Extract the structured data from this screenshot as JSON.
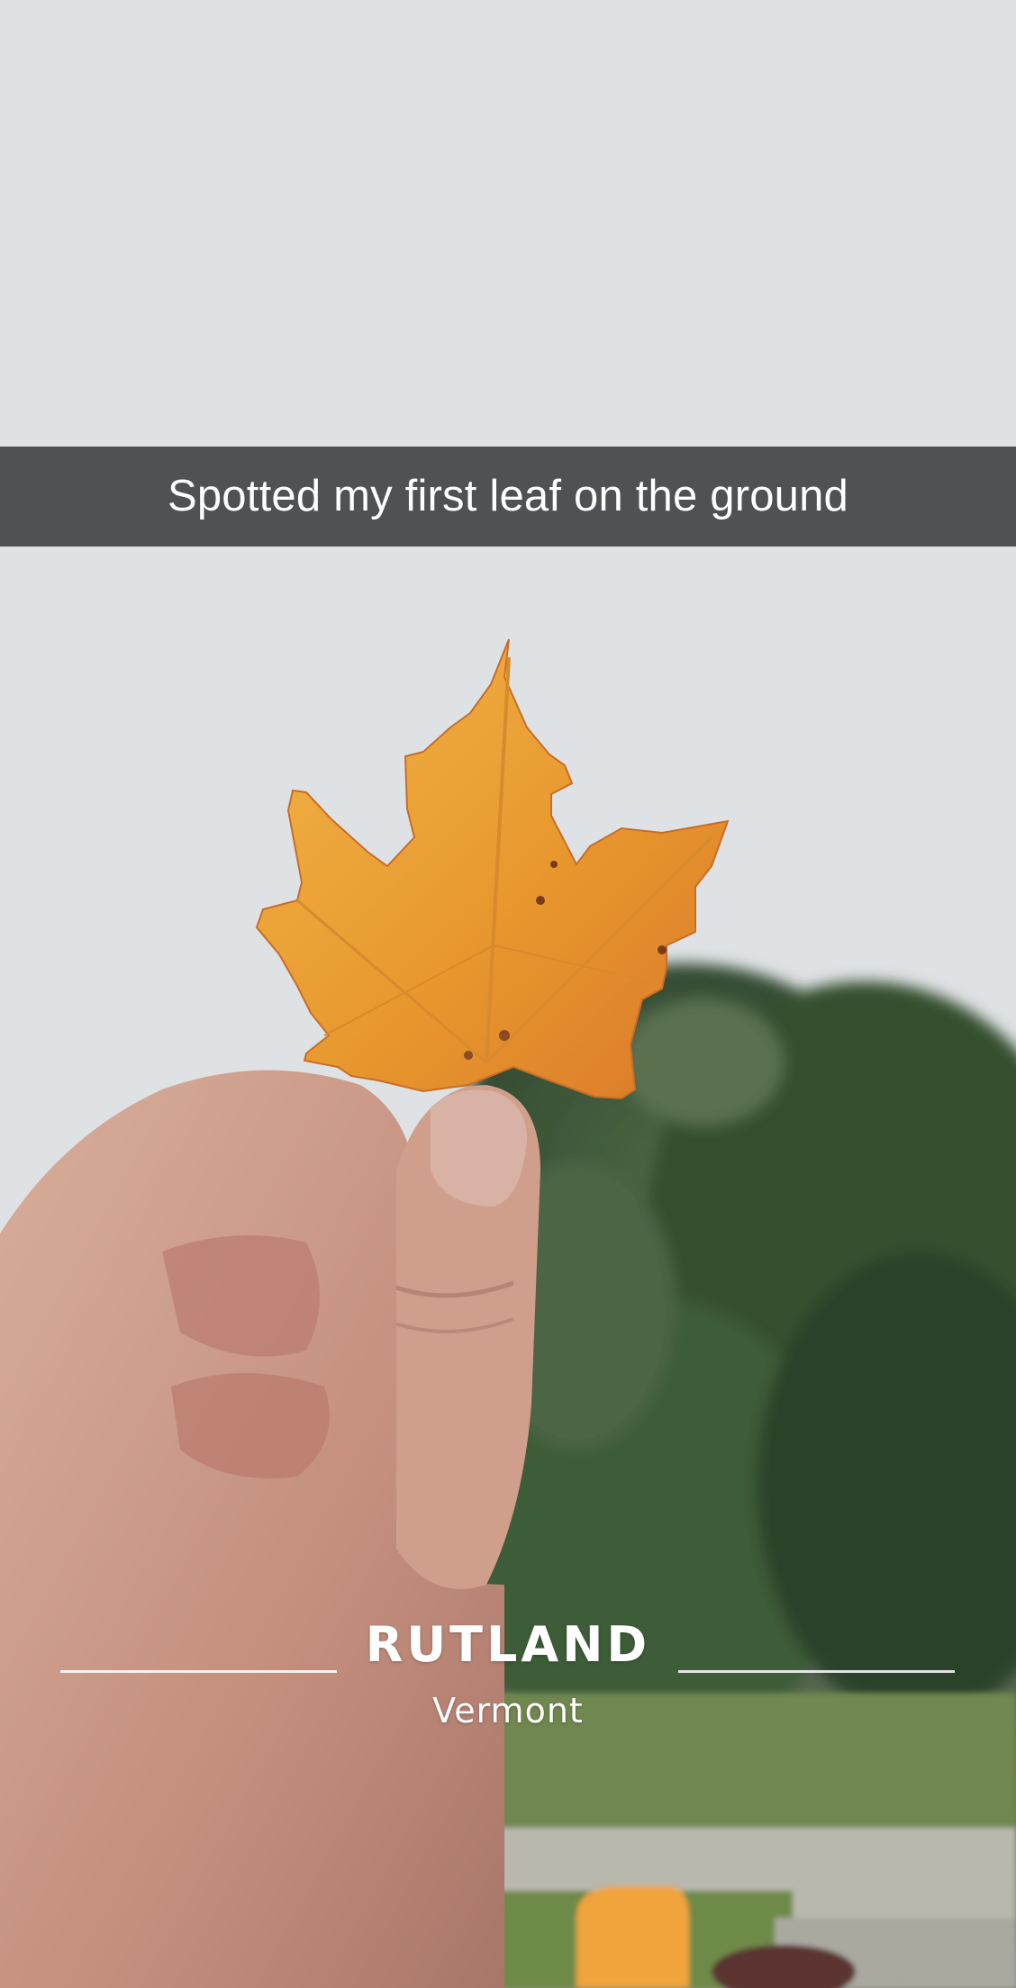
{
  "caption": {
    "text": "Spotted my first leaf on the ground"
  },
  "geofilter": {
    "city": "RUTLAND",
    "state": "Vermont"
  },
  "photo": {
    "subject": "maple-leaf-held-in-hand",
    "colors": {
      "sky": "#dfe2e5",
      "leaf": "#e8a033",
      "trees": "#3f5a38",
      "skin": "#c99a88"
    }
  }
}
